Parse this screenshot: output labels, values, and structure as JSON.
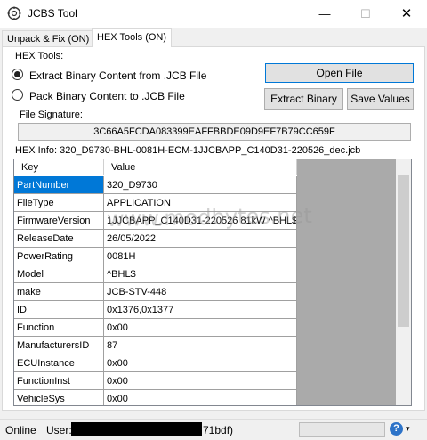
{
  "window": {
    "title": "JCBS Tool",
    "minimize": "—",
    "maximize": "☐",
    "close": "✕"
  },
  "tabs": [
    {
      "label": "Unpack & Fix (ON)"
    },
    {
      "label": "HEX Tools (ON)"
    }
  ],
  "hex_tools": {
    "group_label": "HEX Tools:",
    "radio_extract": "Extract Binary Content from .JCB File",
    "radio_pack": "Pack Binary Content to .JCB File",
    "open_file": "Open File",
    "extract_binary": "Extract Binary",
    "save_values": "Save Values"
  },
  "signature": {
    "label": "File Signature:",
    "value": "3C66A5FCDA083399EAFFBBDE09D9EF7B79CC659F"
  },
  "hex_info": {
    "label": "HEX Info: 320_D9730-BHL-0081H-ECM-1JJCBAPP_C140D31-220526_dec.jcb"
  },
  "grid": {
    "col_key": "Key",
    "col_value": "Value",
    "rows": [
      {
        "key": "PartNumber",
        "value": "320_D9730"
      },
      {
        "key": "FileType",
        "value": "APPLICATION"
      },
      {
        "key": "FirmwareVersion",
        "value": "1JJCBAPP_C140D31-220526 81kW ^BHL$"
      },
      {
        "key": "ReleaseDate",
        "value": "26/05/2022"
      },
      {
        "key": "PowerRating",
        "value": "0081H"
      },
      {
        "key": "Model",
        "value": "^BHL$"
      },
      {
        "key": "make",
        "value": "JCB-STV-448"
      },
      {
        "key": "ID",
        "value": "0x1376,0x1377"
      },
      {
        "key": "Function",
        "value": "0x00"
      },
      {
        "key": "ManufacturersID",
        "value": "87"
      },
      {
        "key": "ECUInstance",
        "value": "0x00"
      },
      {
        "key": "FunctionInst",
        "value": "0x00"
      },
      {
        "key": "VehicleSys",
        "value": "0x00"
      }
    ]
  },
  "watermark": "www.modbytes.net",
  "status": {
    "online": "Online",
    "user_label": "User:",
    "user_suffix": "71bdf)",
    "help": "?",
    "help_arrow": "▾"
  }
}
